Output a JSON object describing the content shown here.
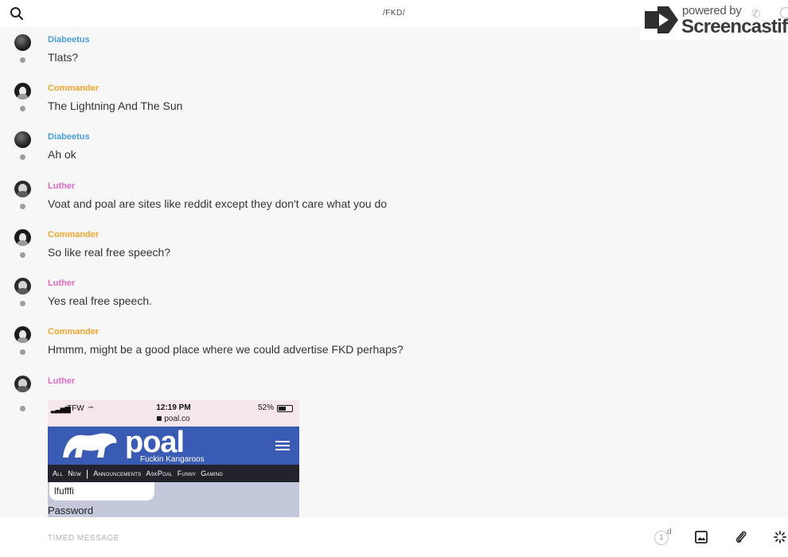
{
  "header": {
    "channel_title": "/FKD/",
    "search_icon": "search-icon"
  },
  "watermark": {
    "small_text": "powered by",
    "big_text": "Screencastify"
  },
  "colors": {
    "diabeetus": "#4a9ed8",
    "commander": "#f2a52d",
    "luther": "#e26bc6"
  },
  "messages": [
    {
      "author": "Diabeetus",
      "text": "Tlats?"
    },
    {
      "author": "Commander",
      "text": "The Lightning And The Sun"
    },
    {
      "author": "Diabeetus",
      "text": "Ah ok"
    },
    {
      "author": "Luther",
      "text": "Voat and poal are sites like reddit except they don't care what you do"
    },
    {
      "author": "Commander",
      "text": "So like real free speech?"
    },
    {
      "author": "Luther",
      "text": "Yes real free speech."
    },
    {
      "author": "Commander",
      "text": "Hmmm, might be a good place where we could advertise FKD perhaps?"
    },
    {
      "author": "Luther",
      "text": ""
    }
  ],
  "attachment": {
    "carrier": "TFW",
    "time": "12:19 PM",
    "battery": "52%",
    "url": "poal.co",
    "logo_text": "poal",
    "subtitle": "Fuckin Kangaroos",
    "nav": [
      "All",
      "New",
      "|",
      "Announcements",
      "AskPoal",
      "Funny",
      "Gaming"
    ],
    "input_value": "lfufffi",
    "password_label": "Password"
  },
  "composer": {
    "placeholder": "TIMED MESSAGE",
    "timer_value": "1",
    "timer_unit": "d"
  }
}
